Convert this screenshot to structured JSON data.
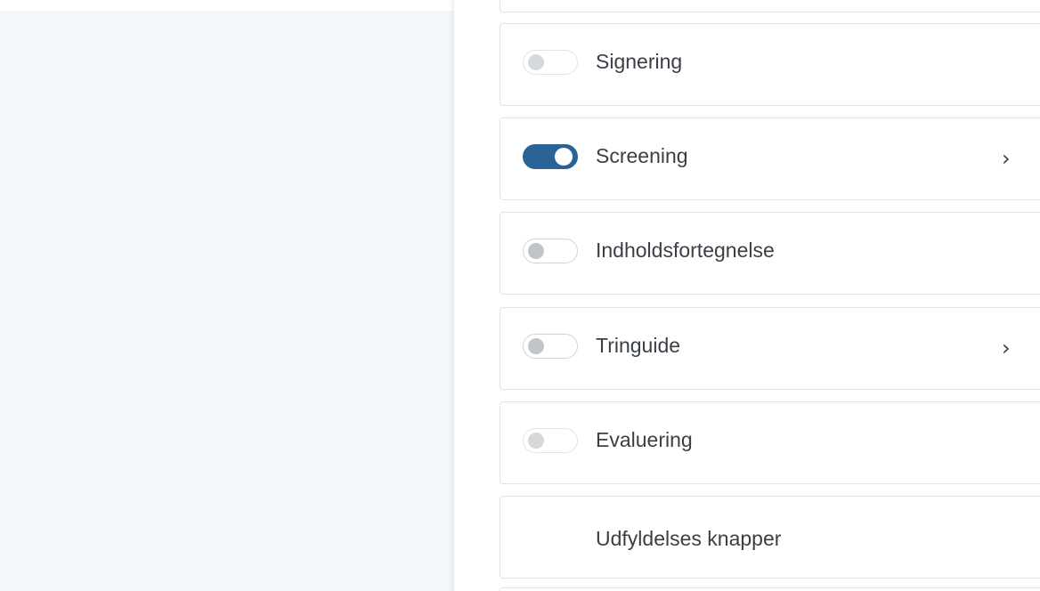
{
  "settings": {
    "items": [
      {
        "label": "Signering",
        "enabled": false,
        "dimmed": true,
        "chevron": ""
      },
      {
        "label": "Screening",
        "enabled": true,
        "dimmed": false,
        "chevron": "›"
      },
      {
        "label": "Indholdsfortegnelse",
        "enabled": false,
        "dimmed": false,
        "chevron": ""
      },
      {
        "label": "Tringuide",
        "enabled": false,
        "dimmed": false,
        "chevron": "›"
      },
      {
        "label": "Evaluering",
        "enabled": false,
        "dimmed": true,
        "chevron": ""
      },
      {
        "label": "Udfyldelses knapper",
        "enabled": null,
        "dimmed": false,
        "chevron": ""
      }
    ]
  },
  "colors": {
    "toggle_on": "#2a6496",
    "left_pane_bg": "#f4f7fa",
    "border": "#dfe3e8"
  }
}
